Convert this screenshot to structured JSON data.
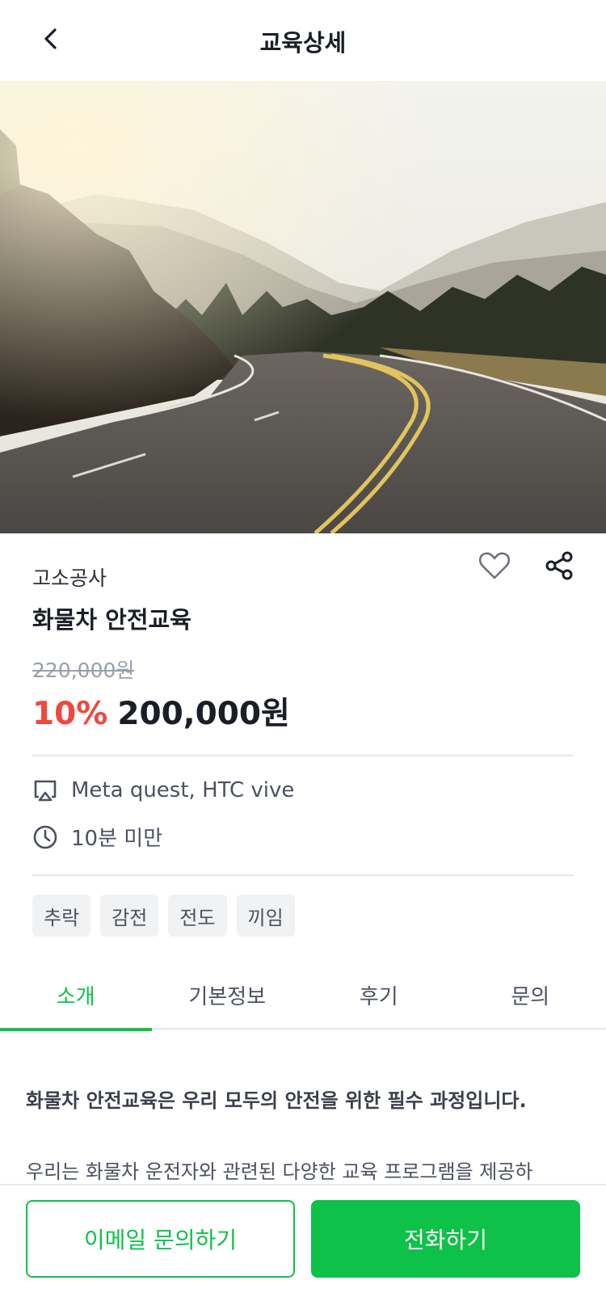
{
  "header": {
    "title": "교육상세",
    "back_icon": "chevron-left-icon"
  },
  "hero": {
    "image": "mountain-road-photo"
  },
  "course": {
    "provider": "고소공사",
    "title": "화물차 안전교육",
    "original_price": "220,000원",
    "discount": "10%",
    "price": "200,000원"
  },
  "specs": [
    {
      "icon": "airplay-icon",
      "text": "Meta quest, HTC vive"
    },
    {
      "icon": "clock-icon",
      "text": "10분 미만"
    }
  ],
  "tags": [
    "추락",
    "감전",
    "전도",
    "끼임"
  ],
  "tabs": [
    {
      "label": "소개",
      "active": true
    },
    {
      "label": "기본정보",
      "active": false
    },
    {
      "label": "후기",
      "active": false
    },
    {
      "label": "문의",
      "active": false
    }
  ],
  "intro": {
    "headline": "화물차 안전교육은 우리 모두의 안전을 위한 필수 과정입니다.",
    "body": "우리는 화물차 운전자와 관련된 다양한 교육 프로그램을 제공하"
  },
  "actions": {
    "email_label": "이메일 문의하기",
    "call_label": "전화하기"
  },
  "colors": {
    "accent": "#0ec149",
    "discount": "#f0483e",
    "text": "#1a1e27"
  }
}
